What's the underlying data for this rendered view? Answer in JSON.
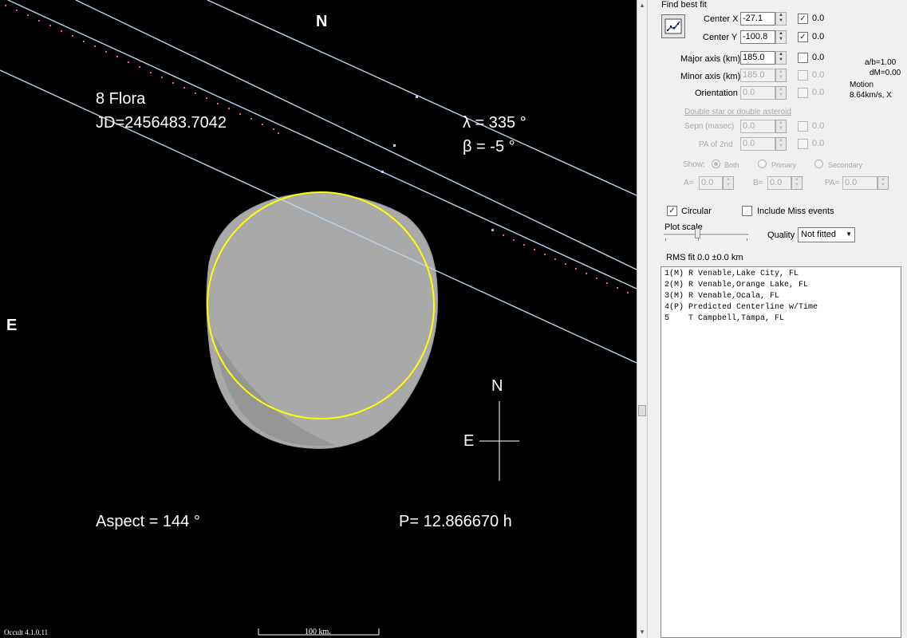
{
  "plot": {
    "asteroid_name": "8 Flora",
    "jd": "JD=2456483.7042",
    "lambda_line": "λ =  335 °",
    "beta_line": "β =   -5 °",
    "north_top": "N",
    "east_left": "E",
    "compass_n": "N",
    "compass_e": "E",
    "aspect": "Aspect = 144 °",
    "period": "P= 12.866670 h",
    "scale_label": "100 km.",
    "version": "Occult 4.1.0.11",
    "colors": {
      "background": "#000000",
      "chords": "#bcd4ee",
      "fit_ellipse": "#ffff00",
      "shape": "#a8a8a8",
      "dots": "#ff5a7a"
    }
  },
  "panel": {
    "find_best_fit": "Find best fit",
    "fit_button_icon": "best-fit-icon",
    "center_x": {
      "label": "Center X",
      "value": "-27.1",
      "checked": true,
      "uncertainty": "0.0"
    },
    "center_y": {
      "label": "Center Y",
      "value": "-100.8",
      "checked": true,
      "uncertainty": "0.0"
    },
    "major_axis": {
      "label": "Major axis (km)",
      "value": "185.0",
      "checked": false,
      "uncertainty": "0.0"
    },
    "minor_axis": {
      "label": "Minor axis (km)",
      "value": "185.0",
      "checked": false,
      "uncertainty": "0.0"
    },
    "orientation": {
      "label": "Orientation",
      "value": "0.0",
      "checked": false,
      "uncertainty": "0.0"
    },
    "ratio_ab": "a/b=1.00",
    "dm": "dM=0.00",
    "motion_label": "Motion",
    "motion_value": "8.64km/s, X",
    "double_star_link": "Double star  or  double asteroid",
    "sepn": {
      "label": "Sepn (masec)",
      "value": "0.0",
      "uncertainty": "0.0"
    },
    "pa2": {
      "label": "PA of 2nd",
      "value": "0.0",
      "uncertainty": "0.0"
    },
    "show_label": "Show:",
    "show_both": "Both",
    "show_primary": "Primary",
    "show_secondary": "Secondary",
    "a_label": "A=",
    "a_value": "0.0",
    "b_label": "B=",
    "b_value": "0.0",
    "pa_label": "PA=",
    "pa_value": "0.0",
    "circular_label": "Circular",
    "circular_checked": true,
    "include_miss_label": "Include Miss events",
    "include_miss_checked": false,
    "plot_scale_label": "Plot scale",
    "quality_label": "Quality",
    "quality_value": "Not fitted",
    "rms_fit": "RMS fit  0.0 ±0.0 km",
    "observers": [
      "1(M) R Venable,Lake City, FL",
      "2(M) R Venable,Orange Lake, FL",
      "3(M) R Venable,Ocala, FL",
      "4(P) Predicted Centerline w/Time",
      "5    T Campbell,Tampa, FL"
    ]
  }
}
